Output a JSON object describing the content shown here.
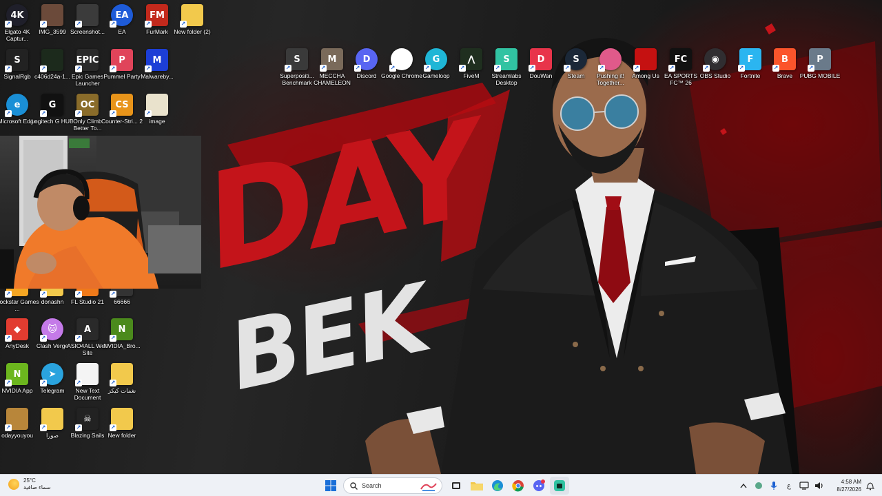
{
  "wallpaper": {
    "line1": "DAY",
    "line2": "BEK",
    "colors": {
      "red": "#c4141a",
      "white": "#e8e8e8"
    }
  },
  "desktop_left": [
    {
      "label": "Elgato 4K Captur...",
      "glyph": "4K",
      "bg": "#1f1f2a",
      "icon": "elgato-icon",
      "round": true
    },
    {
      "label": "IMG_3599",
      "glyph": "",
      "bg": "#6b4a3a",
      "icon": "photo-thumbnail-icon"
    },
    {
      "label": "Screenshot...",
      "glyph": "",
      "bg": "#3b3b3b",
      "icon": "screenshot-thumbnail-icon"
    },
    {
      "label": "EA",
      "glyph": "EA",
      "bg": "#1e5bd8",
      "icon": "ea-icon",
      "round": true
    },
    {
      "label": "FurMark",
      "glyph": "FM",
      "bg": "#c2291c",
      "icon": "furmark-icon"
    },
    {
      "label": "New folder (2)",
      "glyph": "",
      "bg": "#f2c94c",
      "icon": "folder-icon"
    },
    {
      "label": "SignalRgb",
      "glyph": "S",
      "bg": "#222",
      "icon": "signalrgb-icon"
    },
    {
      "label": "c406d24a-1...",
      "glyph": "",
      "bg": "#1c2a1c",
      "icon": "file-thumbnail-icon"
    },
    {
      "label": "Epic Games Launcher",
      "glyph": "EPIC",
      "bg": "#2a2a2a",
      "icon": "epic-games-icon"
    },
    {
      "label": "Pummel Party",
      "glyph": "P",
      "bg": "#e0445a",
      "icon": "pummel-party-icon"
    },
    {
      "label": "Malwareby...",
      "glyph": "M",
      "bg": "#1c3ed6",
      "icon": "malwarebytes-icon"
    },
    {
      "label": "Microsoft Edge",
      "glyph": "e",
      "bg": "#1a8fd6",
      "icon": "edge-icon",
      "round": true
    },
    {
      "label": "Logitech G HUB",
      "glyph": "G",
      "bg": "#111",
      "icon": "logitech-ghub-icon"
    },
    {
      "label": "Only Climb Better To...",
      "glyph": "OC",
      "bg": "#8a6c2a",
      "icon": "game-icon"
    },
    {
      "label": "Counter-Stri... 2",
      "glyph": "CS",
      "bg": "#e8941a",
      "icon": "counter-strike-icon"
    },
    {
      "label": "image",
      "glyph": "",
      "bg": "#e9e2cc",
      "icon": "image-file-icon"
    },
    {
      "label": "Rockstar Games ...",
      "glyph": "R",
      "bg": "#f5a623",
      "icon": "rockstar-icon"
    },
    {
      "label": "donashn",
      "glyph": "",
      "bg": "#f2c94c",
      "icon": "folder-icon"
    },
    {
      "label": "FL Studio 21",
      "glyph": "FL",
      "bg": "#f07a1a",
      "icon": "fl-studio-icon"
    },
    {
      "label": "66666",
      "glyph": "",
      "bg": "#333",
      "icon": "file-icon"
    },
    {
      "label": "AnyDesk",
      "glyph": "◆",
      "bg": "#e23c30",
      "icon": "anydesk-icon"
    },
    {
      "label": "Clash Verge",
      "glyph": "🐱",
      "bg": "#c47ae8",
      "icon": "clash-verge-icon",
      "round": true
    },
    {
      "label": "ASIO4ALL Web Site",
      "glyph": "A",
      "bg": "#2a2a2a",
      "icon": "asio4all-icon"
    },
    {
      "label": "NVIDIA_Bro...",
      "glyph": "N",
      "bg": "#4b8a1c",
      "icon": "nvidia-broadcast-icon"
    },
    {
      "label": "NVIDIA App",
      "glyph": "N",
      "bg": "#6cb61e",
      "icon": "nvidia-app-icon"
    },
    {
      "label": "Telegram",
      "glyph": "➤",
      "bg": "#2aa3de",
      "icon": "telegram-icon",
      "round": true
    },
    {
      "label": "New Text Document",
      "glyph": "",
      "bg": "#f4f4f4",
      "icon": "text-document-icon"
    },
    {
      "label": "نغمات كيكز",
      "glyph": "",
      "bg": "#f2c94c",
      "icon": "folder-icon"
    },
    {
      "label": "odayyouyou",
      "glyph": "",
      "bg": "#b8863a",
      "icon": "photo-thumbnail-icon"
    },
    {
      "label": "صورا",
      "glyph": "",
      "bg": "#f2c94c",
      "icon": "folder-icon"
    },
    {
      "label": "Blazing Sails",
      "glyph": "☠",
      "bg": "#222",
      "icon": "blazing-sails-icon"
    },
    {
      "label": "New folder",
      "glyph": "",
      "bg": "#f2c94c",
      "icon": "folder-icon"
    }
  ],
  "desktop_top": [
    {
      "label": "Superpositi... Benchmark",
      "glyph": "S",
      "bg": "#3a3a3a",
      "icon": "superposition-icon"
    },
    {
      "label": "MECCHA CHAMELEON",
      "glyph": "M",
      "bg": "#7a6a5a",
      "icon": "meccha-chameleon-icon"
    },
    {
      "label": "Discord",
      "glyph": "D",
      "bg": "#5865f2",
      "icon": "discord-icon",
      "round": true
    },
    {
      "label": "Google Chrome",
      "glyph": "",
      "bg": "#ffffff",
      "icon": "chrome-icon",
      "round": true
    },
    {
      "label": "Gameloop",
      "glyph": "G",
      "bg": "#1fb6d6",
      "icon": "gameloop-icon",
      "round": true
    },
    {
      "label": "FiveM",
      "glyph": "⋀",
      "bg": "#1f2f1f",
      "icon": "fivem-icon"
    },
    {
      "label": "Streamlabs Desktop",
      "glyph": "S",
      "bg": "#31c3a2",
      "icon": "streamlabs-icon"
    },
    {
      "label": "DouWan",
      "glyph": "D",
      "bg": "#e8344a",
      "icon": "douwan-icon"
    },
    {
      "label": "Steam",
      "glyph": "S",
      "bg": "#1b2838",
      "icon": "steam-icon",
      "round": true
    },
    {
      "label": "Pushing it! Together...",
      "glyph": "",
      "bg": "#e05a8a",
      "icon": "pushing-it-icon",
      "round": true
    },
    {
      "label": "Among Us",
      "glyph": "",
      "bg": "#c51111",
      "icon": "among-us-icon"
    },
    {
      "label": "EA SPORTS FC™ 26",
      "glyph": "FC",
      "bg": "#111",
      "icon": "ea-fc-icon"
    },
    {
      "label": "OBS Studio",
      "glyph": "◉",
      "bg": "#302e31",
      "icon": "obs-icon",
      "round": true
    },
    {
      "label": "Fortnite",
      "glyph": "F",
      "bg": "#2bb5f0",
      "icon": "fortnite-icon"
    },
    {
      "label": "Brave",
      "glyph": "B",
      "bg": "#fb542b",
      "icon": "brave-icon"
    },
    {
      "label": "PUBG MOBILE",
      "glyph": "P",
      "bg": "#6a7a8a",
      "icon": "pubg-mobile-icon"
    }
  ],
  "taskbar": {
    "weather_temp": "25°C",
    "weather_desc": "سماء صافية",
    "search_placeholder": "Search",
    "lang": "ع",
    "time": "4:58 AM",
    "date": "8/27/2026"
  }
}
